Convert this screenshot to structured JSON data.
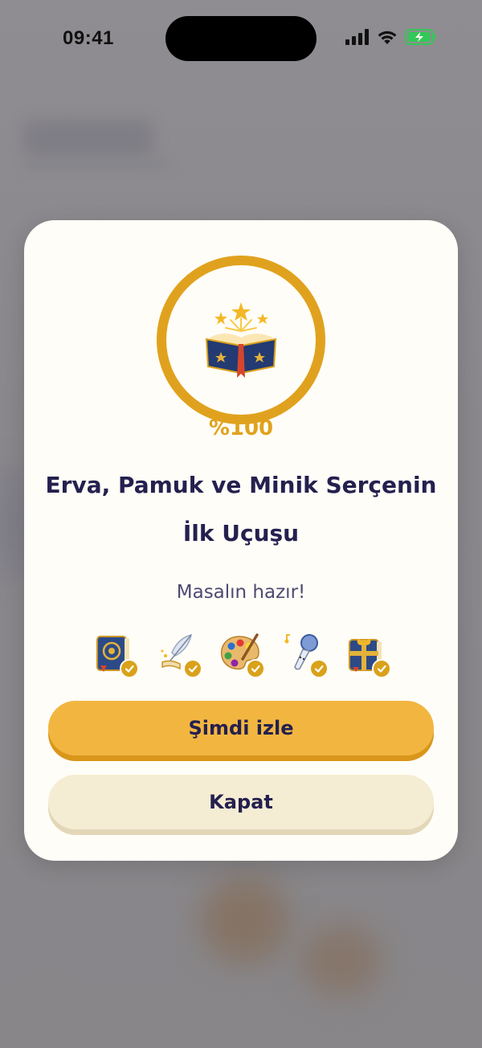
{
  "status_bar": {
    "time": "09:41",
    "icons": [
      "signal-icon",
      "wifi-icon",
      "battery-charging-icon"
    ],
    "battery_color": "#34c759"
  },
  "modal": {
    "progress_percent": 100,
    "progress_label": "%100",
    "cover_icon": "magic-book-icon",
    "title_line1": "Erva, Pamuk ve Minik Serçenin",
    "title_line2": "İlk Uçuşu",
    "subtitle": "Masalın hazır!",
    "steps": [
      {
        "icon": "story-book-icon",
        "done": true
      },
      {
        "icon": "quill-pen-icon",
        "done": true
      },
      {
        "icon": "paint-palette-icon",
        "done": true
      },
      {
        "icon": "microphone-icon",
        "done": true
      },
      {
        "icon": "gift-book-icon",
        "done": true
      }
    ],
    "primary_button": "Şimdi izle",
    "secondary_button": "Kapat"
  },
  "colors": {
    "accent": "#e0a21e",
    "primary_button": "#f2b640",
    "secondary_button": "#f5ecd4",
    "title": "#24204f"
  }
}
